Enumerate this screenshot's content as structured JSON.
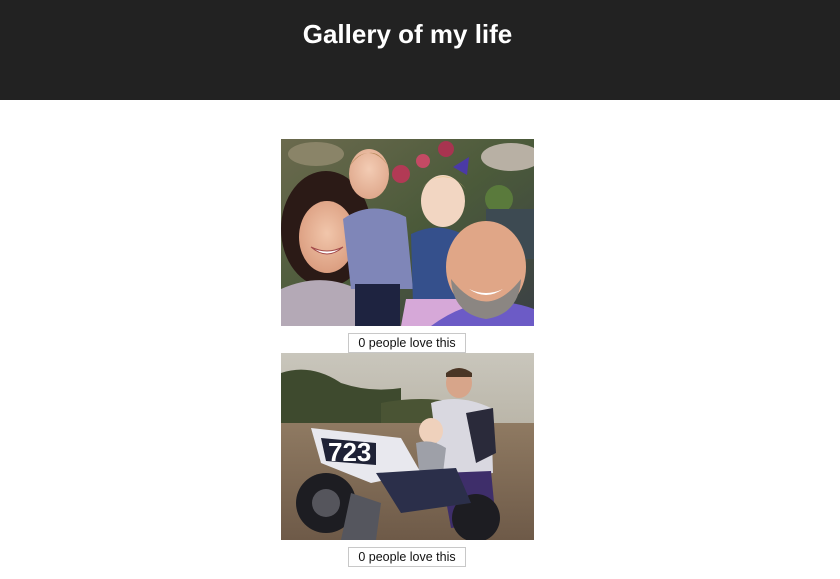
{
  "header": {
    "title": "Gallery of my life",
    "background_color": "#222222",
    "title_color": "#ffffff"
  },
  "gallery": {
    "items": [
      {
        "image": "family-selfie-photo",
        "love_label": "0 people love this"
      },
      {
        "image": "dirt-bike-photo",
        "love_label": "0 people love this"
      }
    ]
  }
}
